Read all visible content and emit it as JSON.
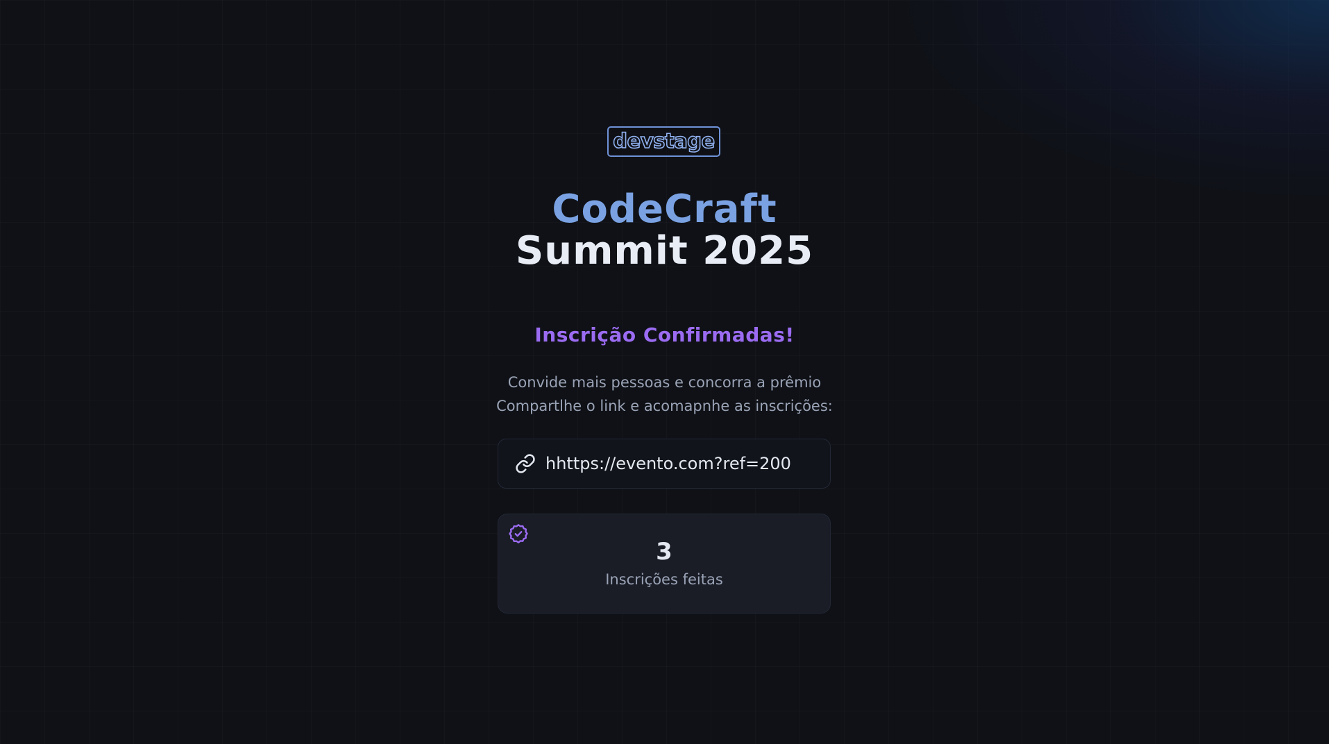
{
  "brand": {
    "logo_text": "devstage"
  },
  "hero": {
    "title_line1": "CodeCraft",
    "title_line2": "Summit 2025"
  },
  "confirmation": {
    "heading": "Inscrição Confirmadas!",
    "description_line1": "Convide mais pessoas e concorra a prêmio",
    "description_line2": "Compartlhe o link e acomapnhe as inscrições:"
  },
  "invite_link": {
    "icon": "link-icon",
    "url": "hhttps://evento.com?ref=200"
  },
  "stats": {
    "icon": "badge-check-icon",
    "count": "3",
    "label": "Inscrições feitas"
  },
  "colors": {
    "background": "#0f1116",
    "accent_blue": "#7aa2e3",
    "accent_purple": "#9b6cf2",
    "text_primary": "#e4e8f0",
    "text_muted": "#9aa3b6",
    "card_bg": "#1a1d26"
  }
}
